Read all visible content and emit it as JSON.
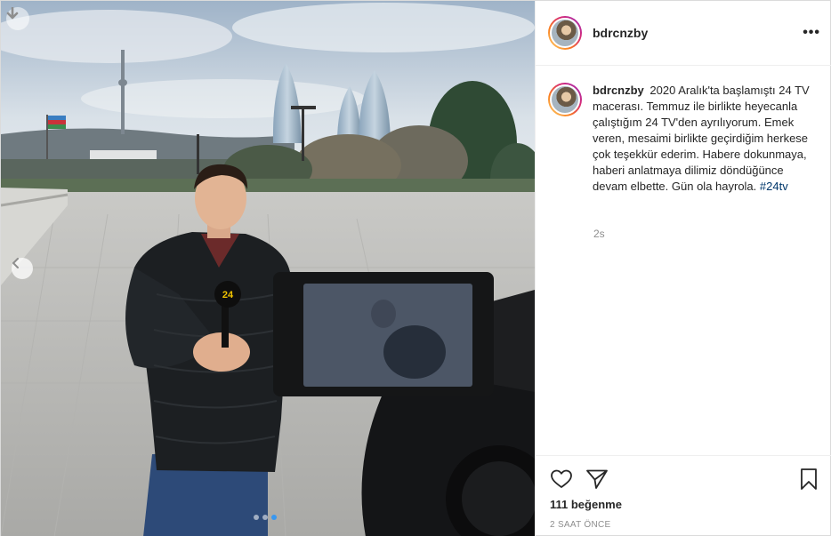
{
  "post": {
    "username": "bdrcnzby",
    "caption_text": "2020 Aralık'ta başlamıştı 24 TV macerası. Temmuz ile birlikte heyecanla çalıştığım 24 TV'den ayrılıyorum. Emek veren, mesaimi birlikte geçirdiğim herkese çok teşekkür ederim. Habere dokunmaya, haberi anlatmaya dilimiz döndüğünce devam elbette. Gün ola hayrola.",
    "hashtag": "#24tv",
    "comment_time": "2s",
    "more_label": "•••",
    "likes": "111 beğenme",
    "posted_ago": "2 SAAT ÖNCE",
    "mic_logo": "24"
  },
  "carousel": {
    "slide_count": 3,
    "active_index": 2
  },
  "icons": {
    "download": "download-arrow-icon",
    "prev": "chevron-left-icon",
    "like": "heart-icon",
    "share": "paper-plane-icon",
    "save": "bookmark-icon",
    "more": "ellipsis-icon"
  },
  "colors": {
    "link": "#00376b",
    "muted": "#8e8e8e",
    "text": "#262626",
    "border": "#dbdbdb"
  }
}
